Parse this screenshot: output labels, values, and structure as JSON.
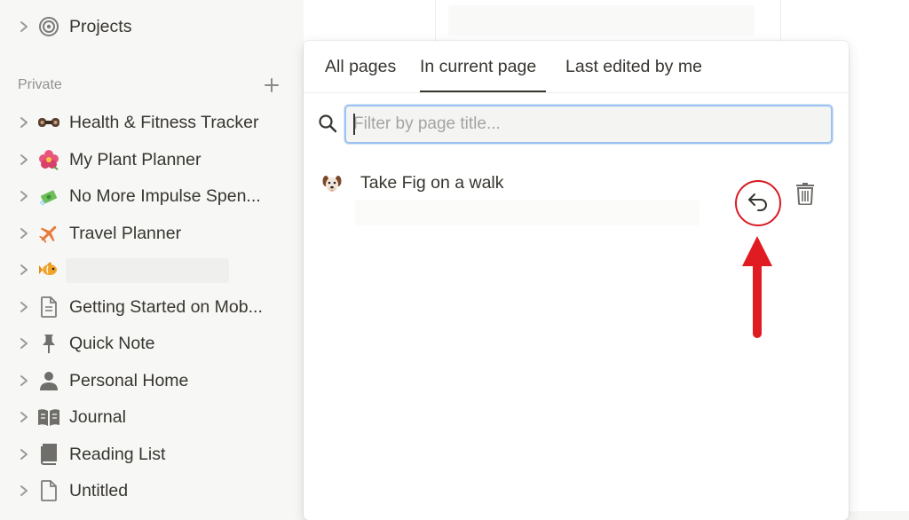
{
  "sidebar": {
    "top_item": {
      "label": "Projects",
      "icon": "target-icon"
    },
    "section_title": "Private",
    "items": [
      {
        "label": "Health & Fitness Tracker",
        "icon": "dumbbell-icon",
        "glyph": "🏋"
      },
      {
        "label": "My Plant Planner",
        "icon": "hibiscus-icon",
        "glyph": "🌺"
      },
      {
        "label": "No More Impulse Spen...",
        "icon": "money-icon",
        "glyph": "💸"
      },
      {
        "label": "Travel Planner",
        "icon": "airplane-icon",
        "glyph": "✈"
      },
      {
        "label": "",
        "icon": "fish-icon",
        "glyph": "🐠"
      },
      {
        "label": "Getting Started on Mob...",
        "icon": "page-icon",
        "glyph": ""
      },
      {
        "label": "Quick Note",
        "icon": "pin-icon",
        "glyph": ""
      },
      {
        "label": "Personal Home",
        "icon": "person-icon",
        "glyph": ""
      },
      {
        "label": "Journal",
        "icon": "book-icon",
        "glyph": ""
      },
      {
        "label": "Reading List",
        "icon": "bookmark-book-icon",
        "glyph": ""
      },
      {
        "label": "Untitled",
        "icon": "page-icon",
        "glyph": ""
      }
    ]
  },
  "popup": {
    "tabs": [
      {
        "label": "All pages"
      },
      {
        "label": "In current page"
      },
      {
        "label": "Last edited by me"
      }
    ],
    "active_tab": "In current page",
    "filter": {
      "placeholder": "Filter by page title...",
      "value": ""
    },
    "results": [
      {
        "title": "Take Fig on a walk",
        "emoji": "🐶"
      }
    ]
  },
  "colors": {
    "accent": "#2383e2",
    "highlight": "#d81b22"
  }
}
